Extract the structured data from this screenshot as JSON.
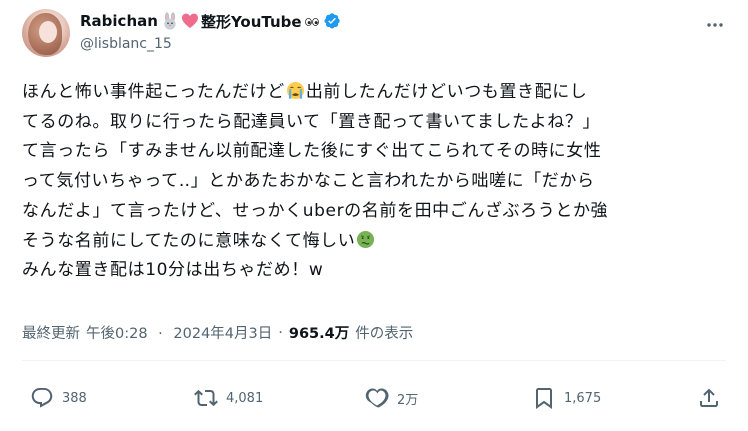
{
  "header": {
    "display_name": "Rabichan",
    "display_name_suffix": "整形YouTube",
    "handle": "@lisblanc_15",
    "emoji_names": [
      "rabbit-face-icon",
      "pink-heart-icon",
      "eyes-icon"
    ]
  },
  "tweet": {
    "lines": [
      {
        "before": "ほんと怖い事件起こったんだけど",
        "emoji": "loudly-crying-face-icon",
        "after": "出前したんだけどいつも置き配にし"
      },
      {
        "before": "てるのね。取りに行ったら配達員いて「置き配って書いてましたよね？」",
        "emoji": "",
        "after": ""
      },
      {
        "before": "て言ったら「すみません以前配達した後にすぐ出てこられてその時に女性",
        "emoji": "",
        "after": ""
      },
      {
        "before": "って気付いちゃって‥」とかあたおかなこと言われたから咄嗟に「だから",
        "emoji": "",
        "after": ""
      },
      {
        "before": "なんだよ」て言ったけど、せっかくuberの名前を田中ごんざぶろうとか強",
        "emoji": "",
        "after": ""
      },
      {
        "before": "そうな名前にしてたのに意味なくて悔しい",
        "emoji": "nauseated-face-icon",
        "after": ""
      },
      {
        "before": "みんな置き配は10分は出ちゃだめ！w",
        "emoji": "",
        "after": ""
      }
    ]
  },
  "meta": {
    "updated_label": "最終更新",
    "time": "午後0:28",
    "separator": "·",
    "date": "2024年4月3日",
    "views_count": "965.4万",
    "views_label": "件の表示"
  },
  "actions": {
    "reply_count": "388",
    "repost_count": "4,081",
    "like_count": "2万",
    "bookmark_count": "1,675"
  },
  "colors": {
    "text": "#0f1419",
    "secondary": "#536471",
    "verified": "#1d9bf0",
    "divider": "#eff3f4"
  }
}
